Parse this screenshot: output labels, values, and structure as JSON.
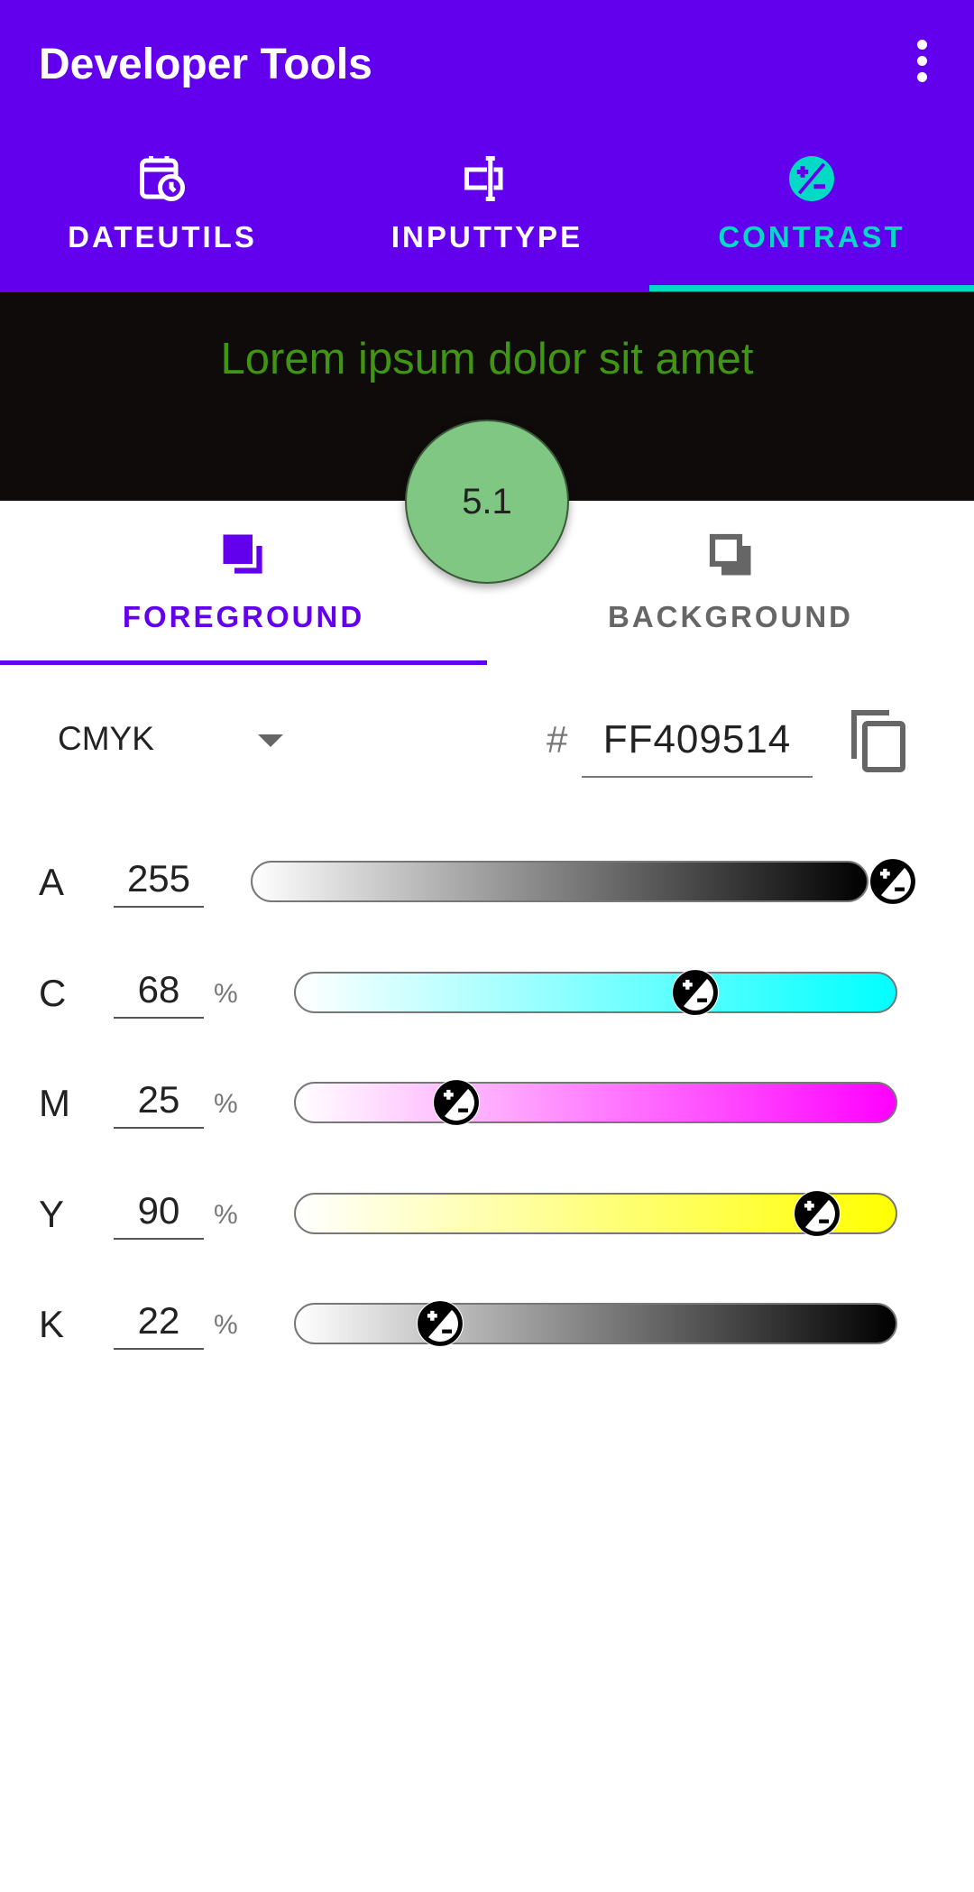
{
  "app_bar": {
    "title": "Developer Tools",
    "menu_icon": "more-vert-icon"
  },
  "tabs": [
    {
      "label": "DATEUTILS",
      "icon": "calendar-clock-icon",
      "active": false
    },
    {
      "label": "INPUTTYPE",
      "icon": "text-input-icon",
      "active": false
    },
    {
      "label": "CONTRAST",
      "icon": "contrast-icon",
      "active": true
    }
  ],
  "preview": {
    "text": "Lorem ipsum dolor sit amet",
    "text_color": "#409514",
    "background_color": "#100B0B"
  },
  "contrast_ratio": "5.1",
  "sub_tabs": [
    {
      "label": "FOREGROUND",
      "icon": "foreground-layers-icon",
      "active": true
    },
    {
      "label": "BACKGROUND",
      "icon": "background-layers-icon",
      "active": false
    }
  ],
  "color_mode": "CMYK",
  "hex_prefix": "#",
  "hex_value": "FF409514",
  "channels": [
    {
      "label": "A",
      "value": "255",
      "unit": "",
      "fraction": 1.0,
      "from": "#ffffff",
      "to": "#000000"
    },
    {
      "label": "C",
      "value": "68",
      "unit": "%",
      "fraction": 0.68,
      "from": "#ffffff",
      "to": "#00ffff"
    },
    {
      "label": "M",
      "value": "25",
      "unit": "%",
      "fraction": 0.25,
      "from": "#ffffff",
      "to": "#ff00ff"
    },
    {
      "label": "Y",
      "value": "90",
      "unit": "%",
      "fraction": 0.9,
      "from": "#ffffff",
      "to": "#ffff00"
    },
    {
      "label": "K",
      "value": "22",
      "unit": "%",
      "fraction": 0.22,
      "from": "#ffffff",
      "to": "#000000"
    }
  ],
  "colors": {
    "primary": "#6200EE",
    "accent": "#03DAC5",
    "ratio_badge": "#81C784"
  }
}
